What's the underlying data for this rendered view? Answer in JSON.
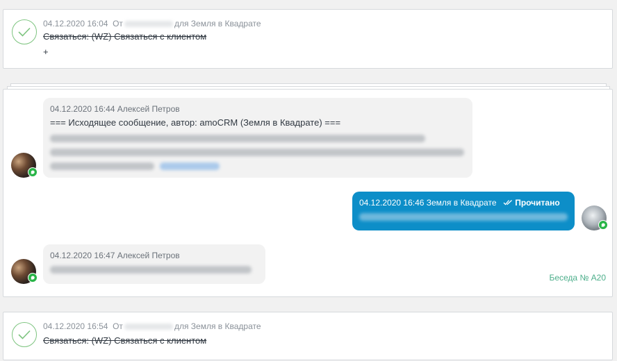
{
  "tasks": [
    {
      "datetime": "04.12.2020 16:04",
      "from_prefix": "От",
      "for_text": "для Земля в Квадрате",
      "text": "Связаться: (WZ) Связаться с клиентом",
      "extra": "+"
    },
    {
      "datetime": "04.12.2020 16:54",
      "from_prefix": "От",
      "for_text": "для Земля в Квадрате",
      "text": "Связаться: (WZ) Связаться с клиентом"
    }
  ],
  "chat": {
    "messages": [
      {
        "meta": "04.12.2020 16:44 Алексей Петров",
        "text": "=== Исходящее сообщение, автор: amoCRM (Земля в Квадрате) ==="
      },
      {
        "meta": "04.12.2020 16:46 Земля в Квадрате",
        "status": "Прочитано"
      },
      {
        "meta": "04.12.2020 16:47 Алексей Петров"
      }
    ],
    "conversation_label": "Беседа № A20"
  },
  "colors": {
    "check": "#7dc47f",
    "outgoing_bubble": "#0d8ec8",
    "whatsapp": "#28b447",
    "conversation_link": "#4cae8a"
  }
}
